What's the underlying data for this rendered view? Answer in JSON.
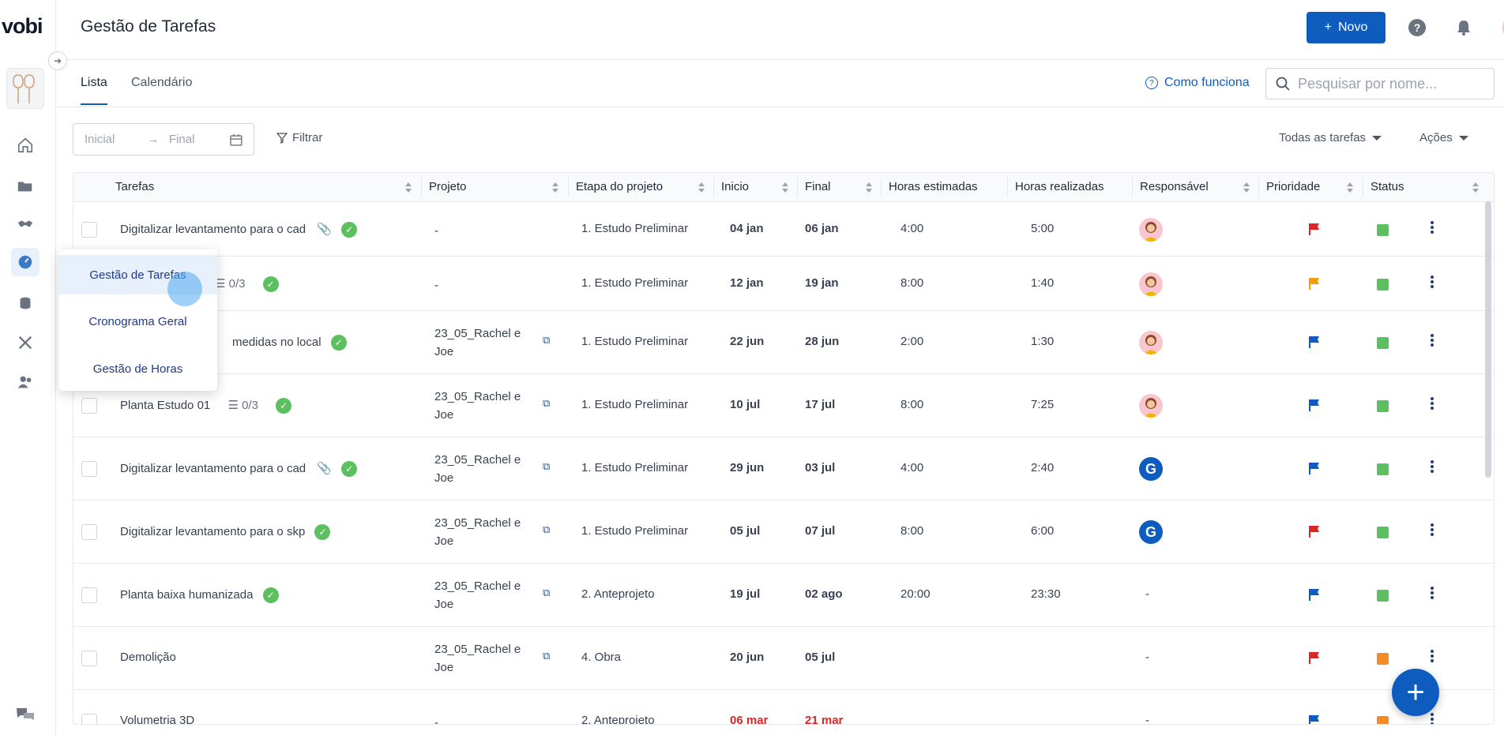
{
  "brand": {
    "logo": "vobi"
  },
  "header": {
    "title": "Gestão de Tarefas",
    "new_button": "Novo",
    "help": "?"
  },
  "tabs": [
    {
      "label": "Lista",
      "active": true
    },
    {
      "label": "Calendário",
      "active": false
    }
  ],
  "how_it_works": "Como funciona",
  "search": {
    "placeholder": "Pesquisar por nome..."
  },
  "filters": {
    "start_placeholder": "Inicial",
    "end_placeholder": "Final",
    "filter_label": "Filtrar",
    "all_tasks": "Todas as tarefas",
    "actions": "Ações"
  },
  "columns": [
    "Tarefas",
    "Projeto",
    "Etapa do projeto",
    "Inicio",
    "Final",
    "Horas estimadas",
    "Horas realizadas",
    "Responsável",
    "Prioridade",
    "Status"
  ],
  "rows": [
    {
      "name": "Digitalizar levantamento para o cad",
      "clip": true,
      "checklist": "",
      "done": true,
      "project": "-",
      "stage": "1. Estudo Preliminar",
      "start": "04 jan",
      "end": "06 jan",
      "est": "4:00",
      "real": "5:00",
      "resp": "avatar",
      "prio": "#dc2626",
      "status": "#5cbf60",
      "overdue": false
    },
    {
      "name": "",
      "clip": false,
      "checklist": "0/3",
      "done": true,
      "project": "-",
      "stage": "1. Estudo Preliminar",
      "start": "12 jan",
      "end": "19 jan",
      "est": "8:00",
      "real": "1:40",
      "resp": "avatar",
      "prio": "#f59e0b",
      "status": "#5cbf60",
      "overdue": false
    },
    {
      "name": "medidas no local",
      "clip": false,
      "checklist": "",
      "done": true,
      "project": "23_05_Rachel e Joe",
      "stage": "1. Estudo Preliminar",
      "start": "22 jun",
      "end": "28 jun",
      "est": "2:00",
      "real": "1:30",
      "resp": "avatar",
      "prio": "#0f5cbf",
      "status": "#5cbf60",
      "overdue": false
    },
    {
      "name": "Planta Estudo 01",
      "clip": false,
      "checklist": "0/3",
      "done": true,
      "project": "23_05_Rachel e Joe",
      "stage": "1. Estudo Preliminar",
      "start": "10 jul",
      "end": "17 jul",
      "est": "8:00",
      "real": "7:25",
      "resp": "avatar",
      "prio": "#0f5cbf",
      "status": "#5cbf60",
      "overdue": false
    },
    {
      "name": "Digitalizar levantamento para o cad",
      "clip": true,
      "checklist": "",
      "done": true,
      "project": "23_05_Rachel e Joe",
      "stage": "1. Estudo Preliminar",
      "start": "29 jun",
      "end": "03 jul",
      "est": "4:00",
      "real": "2:40",
      "resp": "G",
      "prio": "#0f5cbf",
      "status": "#5cbf60",
      "overdue": false
    },
    {
      "name": "Digitalizar levantamento para o skp",
      "clip": false,
      "checklist": "",
      "done": true,
      "project": "23_05_Rachel e Joe",
      "stage": "1. Estudo Preliminar",
      "start": "05 jul",
      "end": "07 jul",
      "est": "8:00",
      "real": "6:00",
      "resp": "G",
      "prio": "#dc2626",
      "status": "#5cbf60",
      "overdue": false
    },
    {
      "name": "Planta baixa humanizada",
      "clip": false,
      "checklist": "",
      "done": true,
      "project": "23_05_Rachel e Joe",
      "stage": "2. Anteprojeto",
      "start": "19 jul",
      "end": "02 ago",
      "est": "20:00",
      "real": "23:30",
      "resp": "-",
      "prio": "#0f5cbf",
      "status": "#5cbf60",
      "overdue": false
    },
    {
      "name": "Demolição",
      "clip": false,
      "checklist": "",
      "done": false,
      "project": "23_05_Rachel e Joe",
      "stage": "4. Obra",
      "start": "20 jun",
      "end": "05 jul",
      "est": "",
      "real": "",
      "resp": "-",
      "prio": "#dc2626",
      "status": "#f28c28",
      "overdue": false
    },
    {
      "name": "Volumetria 3D",
      "clip": false,
      "checklist": "",
      "done": false,
      "project": "-",
      "stage": "2. Anteprojeto",
      "start": "06 mar",
      "end": "21 mar",
      "est": "",
      "real": "",
      "resp": "-",
      "prio": "#0f5cbf",
      "status": "#f28c28",
      "overdue": true
    }
  ],
  "popup_menu": [
    "Gestão de Tarefas",
    "Cronograma Geral",
    "Gestão de Horas"
  ],
  "fab": "+"
}
